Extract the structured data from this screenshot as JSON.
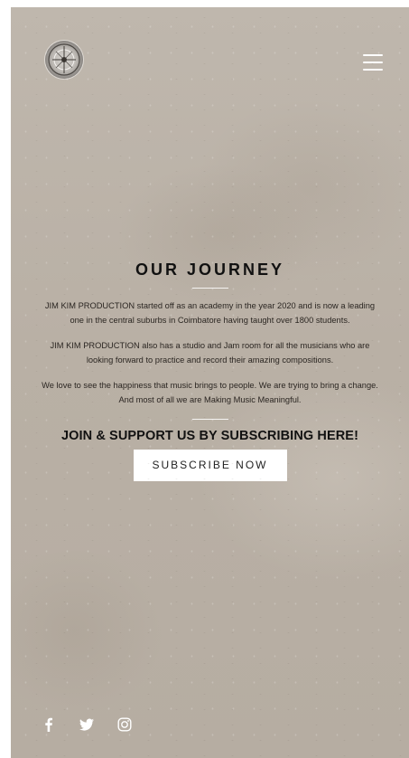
{
  "header": {
    "logo_icon": "circular-emblem-logo",
    "menu_icon": "hamburger-menu-icon"
  },
  "main": {
    "title": "OUR JOURNEY",
    "paragraphs": [
      "JIM KIM PRODUCTION started off as an academy in the year 2020 and is now a leading one in the central suburbs in Coimbatore having taught over 1800 students.",
      "JIM KIM PRODUCTION also has a studio and Jam room for all the musicians who are looking forward to practice and record their amazing compositions.",
      "We love to see the happiness that music brings to people. We are trying to bring a change. And most of all we are Making Music Meaningful."
    ],
    "cta_heading": "JOIN & SUPPORT US BY SUBSCRIBING HERE!",
    "subscribe_label": "SUBSCRIBE NOW"
  },
  "social": {
    "icons": [
      "facebook-icon",
      "twitter-icon",
      "instagram-icon"
    ]
  },
  "colors": {
    "background": "#bcb3a8",
    "text": "#111111",
    "button_bg": "#ffffff",
    "icon": "#ffffff"
  }
}
